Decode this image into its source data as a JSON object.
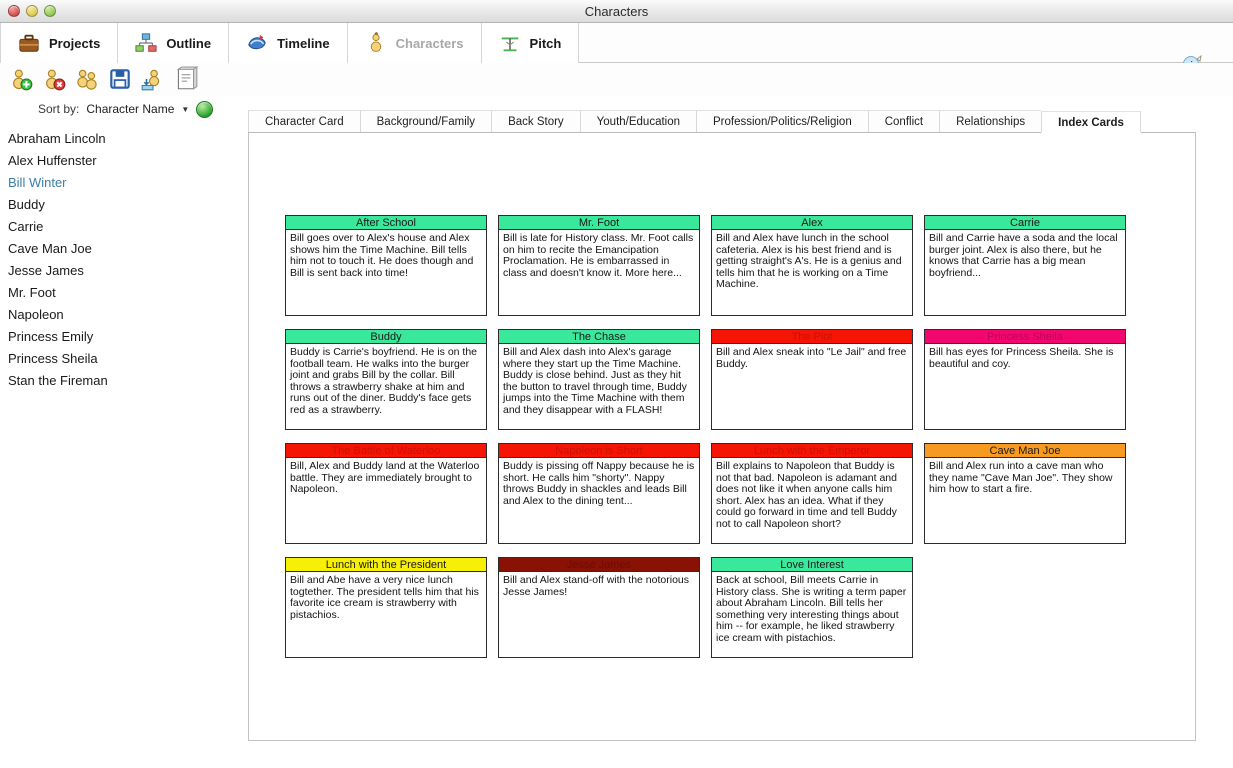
{
  "window": {
    "title": "Characters",
    "buttons": [
      "close",
      "minimize",
      "maximize"
    ]
  },
  "modes": [
    {
      "label": "Projects",
      "icon": "briefcase-icon",
      "active": false
    },
    {
      "label": "Outline",
      "icon": "outline-tree-icon",
      "active": false
    },
    {
      "label": "Timeline",
      "icon": "timeline-icon",
      "active": false
    },
    {
      "label": "Characters",
      "icon": "characters-icon",
      "active": true
    },
    {
      "label": "Pitch",
      "icon": "pitch-icon",
      "active": false
    }
  ],
  "info_button": {
    "label": "i",
    "icon": "info-icon"
  },
  "toolbar": {
    "buttons": [
      {
        "name": "add-character-button",
        "icon": "character-add-icon"
      },
      {
        "name": "delete-character-button",
        "icon": "character-delete-icon"
      },
      {
        "name": "duplicate-character-button",
        "icon": "character-duplicate-icon"
      },
      {
        "name": "save-button",
        "icon": "save-floppy-icon"
      },
      {
        "name": "import-character-button",
        "icon": "character-import-icon"
      },
      {
        "name": "report-button",
        "icon": "book-report-icon"
      }
    ]
  },
  "sidebar": {
    "sort_label": "Sort by:",
    "sort_value": "Character Name",
    "sort_caret": "▼",
    "globe_button": "globe-button",
    "characters": [
      {
        "name": "Abraham Lincoln",
        "selected": false
      },
      {
        "name": "Alex Huffenster",
        "selected": false
      },
      {
        "name": "Bill Winter",
        "selected": true
      },
      {
        "name": "Buddy",
        "selected": false
      },
      {
        "name": "Carrie",
        "selected": false
      },
      {
        "name": "Cave Man Joe",
        "selected": false
      },
      {
        "name": "Jesse James",
        "selected": false
      },
      {
        "name": "Mr. Foot",
        "selected": false
      },
      {
        "name": "Napoleon",
        "selected": false
      },
      {
        "name": "Princess Emily",
        "selected": false
      },
      {
        "name": "Princess Sheila",
        "selected": false
      },
      {
        "name": "Stan the Fireman",
        "selected": false
      }
    ]
  },
  "main": {
    "tabs": [
      {
        "label": "Character Card",
        "active": false
      },
      {
        "label": "Background/Family",
        "active": false
      },
      {
        "label": "Back Story",
        "active": false
      },
      {
        "label": "Youth/Education",
        "active": false
      },
      {
        "label": "Profession/Politics/Religion",
        "active": false
      },
      {
        "label": "Conflict",
        "active": false
      },
      {
        "label": "Relationships",
        "active": false
      },
      {
        "label": "Index Cards",
        "active": true
      }
    ],
    "cards": [
      {
        "title": "After School",
        "body": "Bill goes over to Alex's house and Alex shows him the Time Machine. Bill tells him not to touch it. He does though and Bill is sent back into time!",
        "header_color": "#3ae89b",
        "title_color": "#1a1a1a"
      },
      {
        "title": "Mr. Foot",
        "body": "Bill is late for History class. Mr. Foot calls on him to recite the Emancipation Proclamation. He is embarrassed in class and doesn't know it. More here...",
        "header_color": "#3ae89b",
        "title_color": "#1a1a1a"
      },
      {
        "title": "Alex",
        "body": "Bill and Alex have lunch in the school cafeteria. Alex is his best friend and is getting straight's A's. He is a genius and tells him that he is working on a Time Machine.",
        "header_color": "#3ae89b",
        "title_color": "#1a1a1a"
      },
      {
        "title": "Carrie",
        "body": "Bill and Carrie have a soda and the local burger joint. Alex is also there, but he knows that Carrie has a big mean boyfriend...",
        "header_color": "#3ae89b",
        "title_color": "#1a1a1a"
      },
      {
        "title": "Buddy",
        "body": "Buddy is Carrie's boyfriend. He is on the football team. He walks into the burger joint and grabs Bill by the collar. Bill throws a strawberry shake at him and runs out of the diner. Buddy's face gets red as a strawberry.",
        "header_color": "#3ae89b",
        "title_color": "#1a1a1a"
      },
      {
        "title": "The Chase",
        "body": "Bill and Alex dash into Alex's garage where they start up the Time Machine. Buddy is close behind. Just as they hit the button to travel through time, Buddy jumps into the Time Machine with them and they disappear with a FLASH!",
        "header_color": "#3ae89b",
        "title_color": "#1a1a1a"
      },
      {
        "title": "The Plot",
        "body": "Bill and Alex sneak into \"Le Jail\" and free Buddy.",
        "header_color": "#f51505",
        "title_color": "#cc1104"
      },
      {
        "title": "Princess Sheila",
        "body": "Bill has eyes for Princess Sheila. She is beautiful and coy.",
        "header_color": "#f2076e",
        "title_color": "#c00458"
      },
      {
        "title": "The Battle of Waterloo",
        "body": "Bill, Alex and Buddy land at the Waterloo battle. They are immediately brought to Napoleon.",
        "header_color": "#f51505",
        "title_color": "#cc1104"
      },
      {
        "title": "Napoleon is Short",
        "body": "Buddy is pissing off Nappy because he is short. He calls him \"shorty\". Nappy throws Buddy in shackles and leads Bill and Alex to the dining tent...",
        "header_color": "#f51505",
        "title_color": "#cc1104"
      },
      {
        "title": "Lunch with the Emperor",
        "body": "Bill explains to Napoleon that Buddy is not that bad. Napoleon is adamant and does not like it when anyone calls him short. Alex has an idea. What if they could go forward in time and tell Buddy not to call Napoleon short?",
        "header_color": "#f51505",
        "title_color": "#cc1104"
      },
      {
        "title": "Cave Man Joe",
        "body": "Bill and Alex run into a cave man who they name \"Cave Man Joe\". They show him how to start a fire.",
        "header_color": "#f79a22",
        "title_color": "#1a1a1a"
      },
      {
        "title": "Lunch with the President",
        "body": "Bill and Abe have a very nice lunch togtether. The president tells him that his favorite ice cream is strawberry with pistachios.",
        "header_color": "#f7ef05",
        "title_color": "#1a1a1a"
      },
      {
        "title": "Jesse James",
        "body": "Bill and Alex stand-off with the notorious Jesse James!",
        "header_color": "#8a1205",
        "title_color": "#6b0d03"
      },
      {
        "title": "Love Interest",
        "body": "Back at school, Bill meets Carrie in History class. She is writing a term paper about Abraham Lincoln. Bill tells her something very interesting things about him -- for example, he liked strawberry ice cream with pistachios.",
        "header_color": "#3ae89b",
        "title_color": "#1a1a1a"
      }
    ]
  }
}
